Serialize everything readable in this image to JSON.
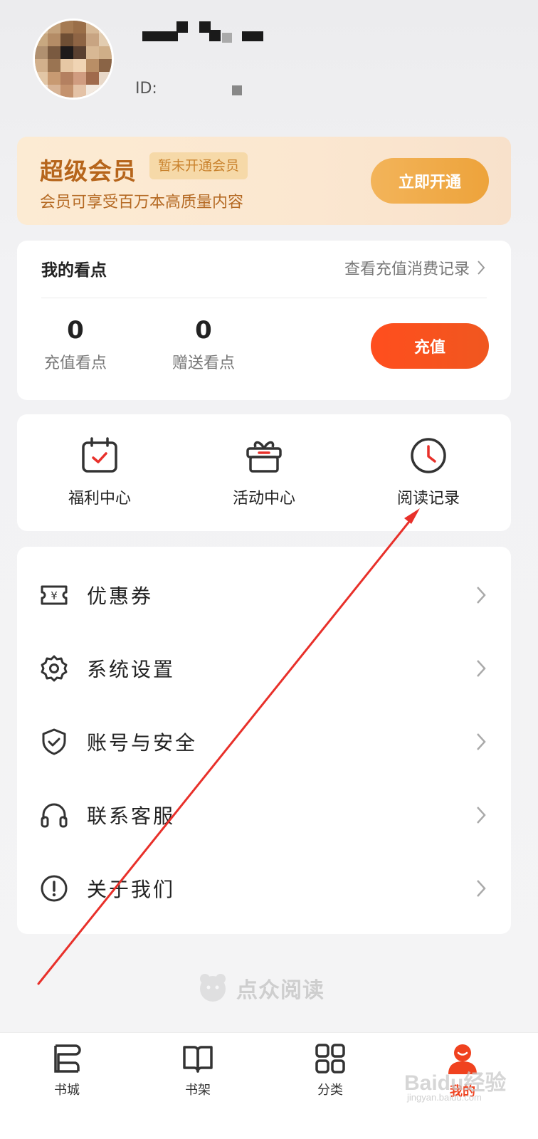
{
  "profile": {
    "id_label": "ID:"
  },
  "vip": {
    "title": "超级会员",
    "badge": "暂未开通会员",
    "description": "会员可享受百万本高质量内容",
    "button_label": "立即开通"
  },
  "points": {
    "title": "我的看点",
    "history_link": "查看充值消费记录",
    "recharge_points": {
      "value": "0",
      "label": "充值看点"
    },
    "gift_points": {
      "value": "0",
      "label": "赠送看点"
    },
    "recharge_button": "充值"
  },
  "shortcuts": [
    {
      "label": "福利中心",
      "icon": "calendar-check-icon"
    },
    {
      "label": "活动中心",
      "icon": "gift-icon"
    },
    {
      "label": "阅读记录",
      "icon": "clock-icon"
    }
  ],
  "menu": [
    {
      "label": "优惠券",
      "icon": "coupon-icon"
    },
    {
      "label": "系统设置",
      "icon": "gear-icon"
    },
    {
      "label": "账号与安全",
      "icon": "shield-icon"
    },
    {
      "label": "联系客服",
      "icon": "headphones-icon"
    },
    {
      "label": "关于我们",
      "icon": "info-icon"
    }
  ],
  "brand": {
    "name": "点众阅读"
  },
  "tabbar": [
    {
      "label": "书城",
      "icon": "bookstore-icon",
      "active": false
    },
    {
      "label": "书架",
      "icon": "book-icon",
      "active": false
    },
    {
      "label": "分类",
      "icon": "grid-icon",
      "active": false
    },
    {
      "label": "我的",
      "icon": "profile-icon",
      "active": true
    }
  ],
  "watermark": {
    "text": "Baidu经验",
    "sub": "jingyan.baidu.com"
  },
  "colors": {
    "accent": "#f0421f",
    "vip_gold": "#b6651b",
    "vip_button": "#eda33b",
    "recharge_button": "#ff4e1e",
    "annotation_arrow": "#e8302a"
  }
}
